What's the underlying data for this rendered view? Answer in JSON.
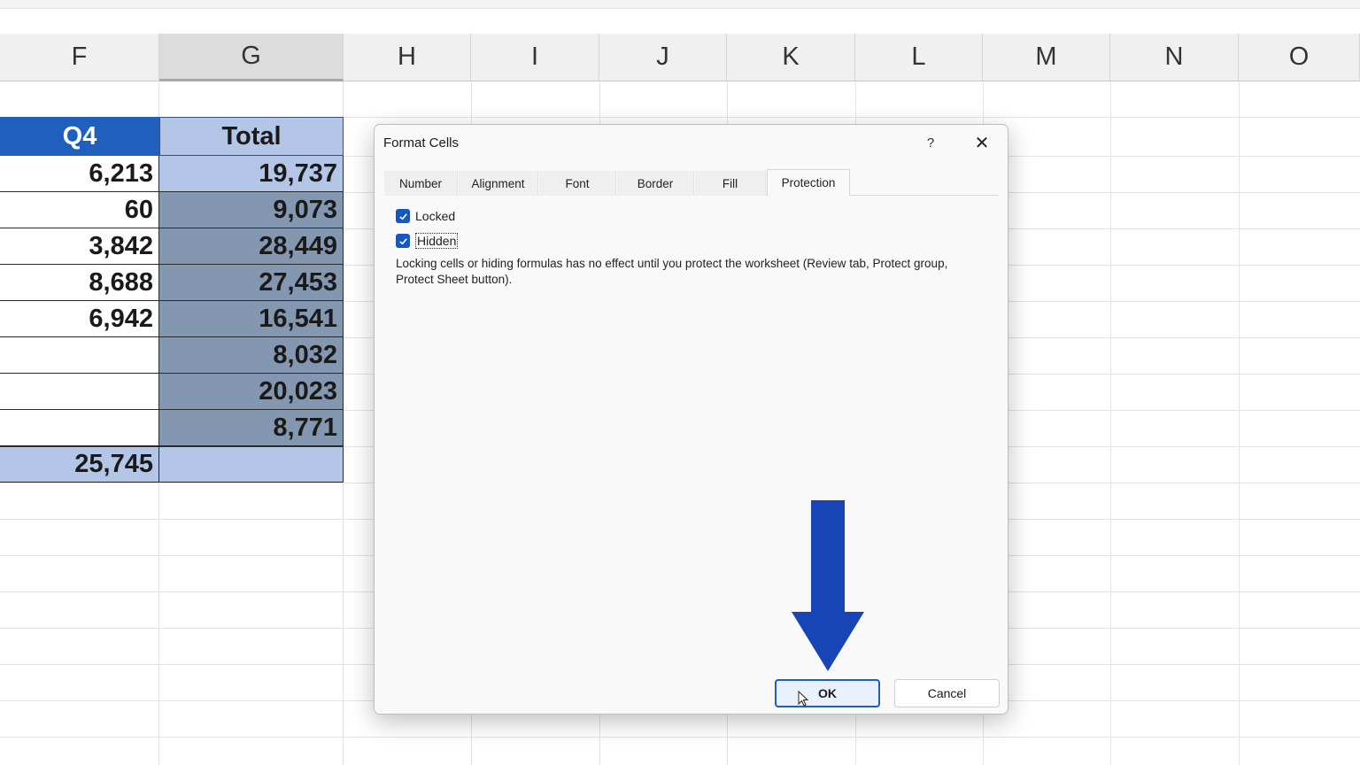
{
  "columns": [
    "F",
    "G",
    "H",
    "I",
    "J",
    "K",
    "L",
    "M",
    "N",
    "O"
  ],
  "table": {
    "header_q4": "Q4",
    "header_total": "Total",
    "rows": [
      {
        "q4": "6,213",
        "total": "19,737"
      },
      {
        "q4": "60",
        "total": "9,073"
      },
      {
        "q4": "3,842",
        "total": "28,449"
      },
      {
        "q4": "8,688",
        "total": "27,453"
      },
      {
        "q4": "6,942",
        "total": "16,541"
      },
      {
        "q4": "",
        "total": "8,032"
      },
      {
        "q4": "",
        "total": "20,023"
      },
      {
        "q4": "",
        "total": "8,771"
      }
    ],
    "sum_q4": "25,745",
    "sum_total": ""
  },
  "colors": {
    "header_blue": "#1f5fbd",
    "light_blue": "#b4c6e7",
    "selection_gray_blue": "#8497b0",
    "arrow_blue": "#1745b5"
  },
  "dialog": {
    "title": "Format Cells",
    "help_symbol": "?",
    "close_symbol": "✕",
    "tabs": [
      "Number",
      "Alignment",
      "Font",
      "Border",
      "Fill",
      "Protection"
    ],
    "active_tab": "Protection",
    "locked_label": "Locked",
    "locked_checked": true,
    "hidden_label": "Hidden",
    "hidden_checked": true,
    "note": "Locking cells or hiding formulas has no effect until you protect the worksheet (Review tab, Protect group, Protect Sheet button).",
    "ok_label": "OK",
    "cancel_label": "Cancel"
  }
}
